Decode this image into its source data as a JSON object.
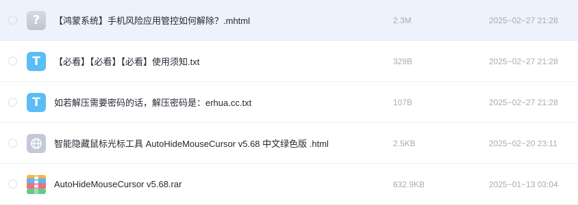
{
  "files": [
    {
      "name": "【鸿蒙系统】手机风险应用管控如何解除？.mhtml",
      "size": "2.3M",
      "date": "2025−02−27 21:28",
      "icon": "unknown-file-icon",
      "icon_glyph": "?",
      "selected": true
    },
    {
      "name": "【必看】【必看】【必看】使用须知.txt",
      "size": "329B",
      "date": "2025−02−27 21:28",
      "icon": "text-file-icon",
      "icon_glyph": "T",
      "selected": false
    },
    {
      "name": "如若解压需要密码的话，解压密码是：erhua.cc.txt",
      "size": "107B",
      "date": "2025−02−27 21:28",
      "icon": "text-file-icon",
      "icon_glyph": "T",
      "selected": false
    },
    {
      "name": "智能隐藏鼠标光标工具 AutoHideMouseCursor v5.68 中文绿色版 .html",
      "size": "2.5KB",
      "date": "2025−02−20 23:11",
      "icon": "web-file-icon",
      "icon_glyph": "",
      "selected": false
    },
    {
      "name": "AutoHideMouseCursor v5.68.rar",
      "size": "632.9KB",
      "date": "2025−01−13 03:04",
      "icon": "archive-file-icon",
      "icon_glyph": "",
      "selected": false
    }
  ],
  "colors": {
    "selected_row_bg": "#eef2fd",
    "txt_icon": "#5bbdf5",
    "meta_text": "#a7abb3",
    "name_text": "#232833"
  }
}
